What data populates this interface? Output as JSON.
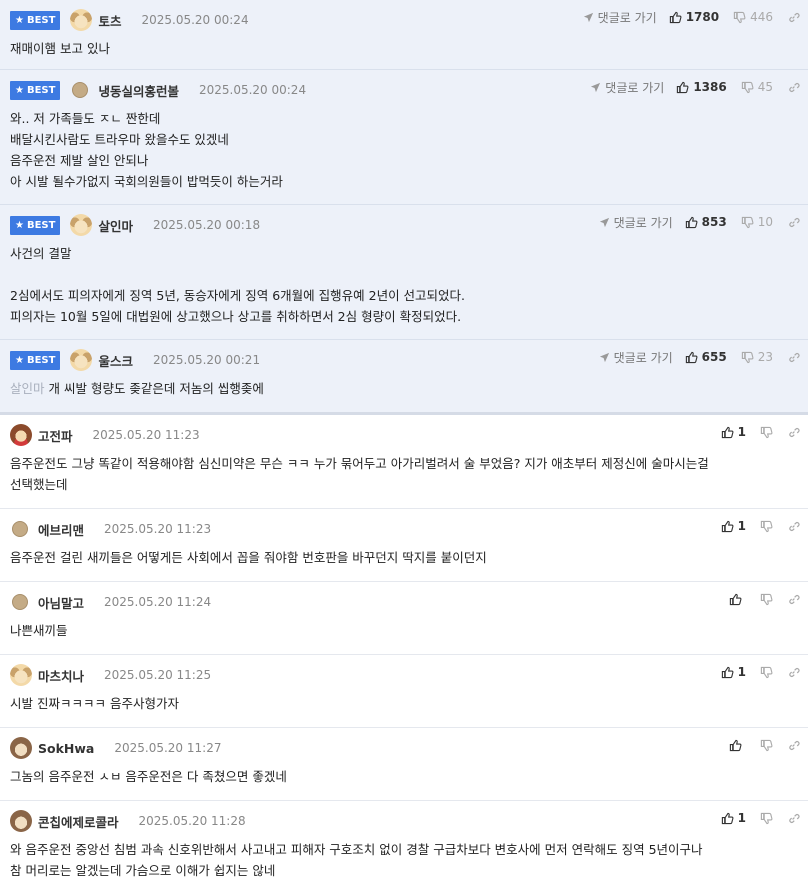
{
  "common": {
    "reply_label": "댓글로 가기"
  },
  "best_badge": "BEST",
  "comments": [
    {
      "nick": "토츠",
      "date": "2025.05.20 00:24",
      "up": "1780",
      "down": "446",
      "text": "재매이햄 보고 있나"
    },
    {
      "nick": "냉동실의홍런볼",
      "date": "2025.05.20 00:24",
      "up": "1386",
      "down": "45",
      "text": "와.. 저 가족들도 ㅈㄴ 짠한데\n배달시킨사람도 트라우마 왔을수도 있겠네\n음주운전 제발 살인 안되나\n아 시발 될수가없지 국회의원들이 밥먹듯이 하는거라"
    },
    {
      "nick": "살인마",
      "date": "2025.05.20 00:18",
      "up": "853",
      "down": "10",
      "text": "사건의 결말\n\n2심에서도 피의자에게 징역 5년, 동승자에게 징역 6개월에 집행유예 2년이 선고되었다.\n피의자는 10월 5일에 대법원에 상고했으나 상고를 취하하면서 2심 형량이 확정되었다."
    },
    {
      "nick": "울스크",
      "date": "2025.05.20 00:21",
      "up": "655",
      "down": "23",
      "mention": "살인마",
      "text": "개 씨발 형량도 좆같은데 저놈의 씹행좆에"
    },
    {
      "nick": "고전파",
      "date": "2025.05.20 11:23",
      "up": "1",
      "text": "음주운전도 그냥 똑같이 적용해야함 심신미약은 무슨 ㅋㅋ 누가 묶어두고 아가리벌려서 술 부었음? 지가 애초부터 제정신에 술마시는걸\n선택했는데"
    },
    {
      "nick": "에브리맨",
      "date": "2025.05.20 11:23",
      "up": "1",
      "text": "음주운전 걸린 새끼들은 어떻게든 사회에서 꼽을 줘야함 번호판을 바꾸던지 딱지를 붙이던지"
    },
    {
      "nick": "아님말고",
      "date": "2025.05.20 11:24",
      "up": "",
      "text": "나쁜새끼들"
    },
    {
      "nick": "마츠치나",
      "date": "2025.05.20 11:25",
      "up": "1",
      "text": "시발 진짜ㅋㅋㅋㅋ 음주사형가자"
    },
    {
      "nick": "SokHwa",
      "date": "2025.05.20 11:27",
      "up": "",
      "text": "그놈의 음주운전 ㅅㅂ 음주운전은 다 족쳤으면 좋겠네"
    },
    {
      "nick": "콘칩에제로콜라",
      "date": "2025.05.20 11:28",
      "up": "1",
      "text": "와 음주운전 중앙선 침범 과속 신호위반해서 사고내고 피해자 구호조치 없이 경찰 구급차보다 변호사에 먼저 연락해도 징역 5년이구나\n참 머리로는 알겠는데 가슴으로 이해가 쉽지는 않네"
    }
  ],
  "colors": {
    "best_bg": "#edf1f9",
    "badge": "#3d7ae2"
  }
}
